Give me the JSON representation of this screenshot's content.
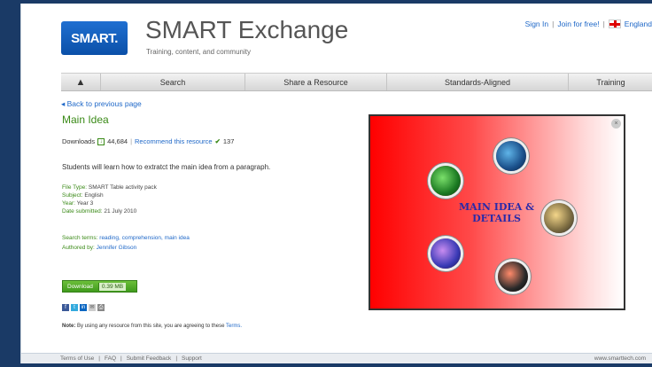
{
  "header": {
    "logo_text": "SMART.",
    "site_title": "SMART Exchange",
    "tagline": "Training, content, and community",
    "sign_in": "Sign In",
    "join": "Join for free!",
    "region": "England"
  },
  "nav": {
    "home_icon": "home-icon",
    "items": [
      "Search",
      "Share a Resource",
      "Standards-Aligned",
      "Training"
    ]
  },
  "resource": {
    "back_link": "Back to previous page",
    "title": "Main Idea",
    "downloads_label": "Downloads",
    "downloads_count": "44,684",
    "recommend": "Recommend this resource",
    "recommend_count": "137",
    "description": "Students will learn how to extratct the main idea from a paragraph.",
    "file_type_label": "File Type:",
    "file_type": "SMART Table activity pack",
    "subject_label": "Subject:",
    "subject": "English",
    "year_label": "Year:",
    "year": "Year 3",
    "date_label": "Date submitted:",
    "date": "21 July 2010",
    "search_terms_label": "Search terms:",
    "search_terms": [
      "reading,",
      "comprehension,",
      "main idea"
    ],
    "author_label": "Authored by:",
    "author": "Jennifer Gibson",
    "download_button": "Download",
    "download_size": "0.39 MB",
    "note_bold": "Note:",
    "note_text": "By using any resource from this site, you are agreeing to these",
    "note_link": "Terms."
  },
  "preview": {
    "title_line1": "MAIN IDEA &",
    "title_line2": "DETAILS"
  },
  "footer": {
    "links": [
      "Terms of Use",
      "FAQ",
      "Submit Feedback",
      "Support"
    ],
    "url": "www.smarttech.com"
  },
  "colors": {
    "accent_blue": "#1f68c8",
    "accent_green": "#3a8a17",
    "page_bg": "#1a3a66"
  }
}
